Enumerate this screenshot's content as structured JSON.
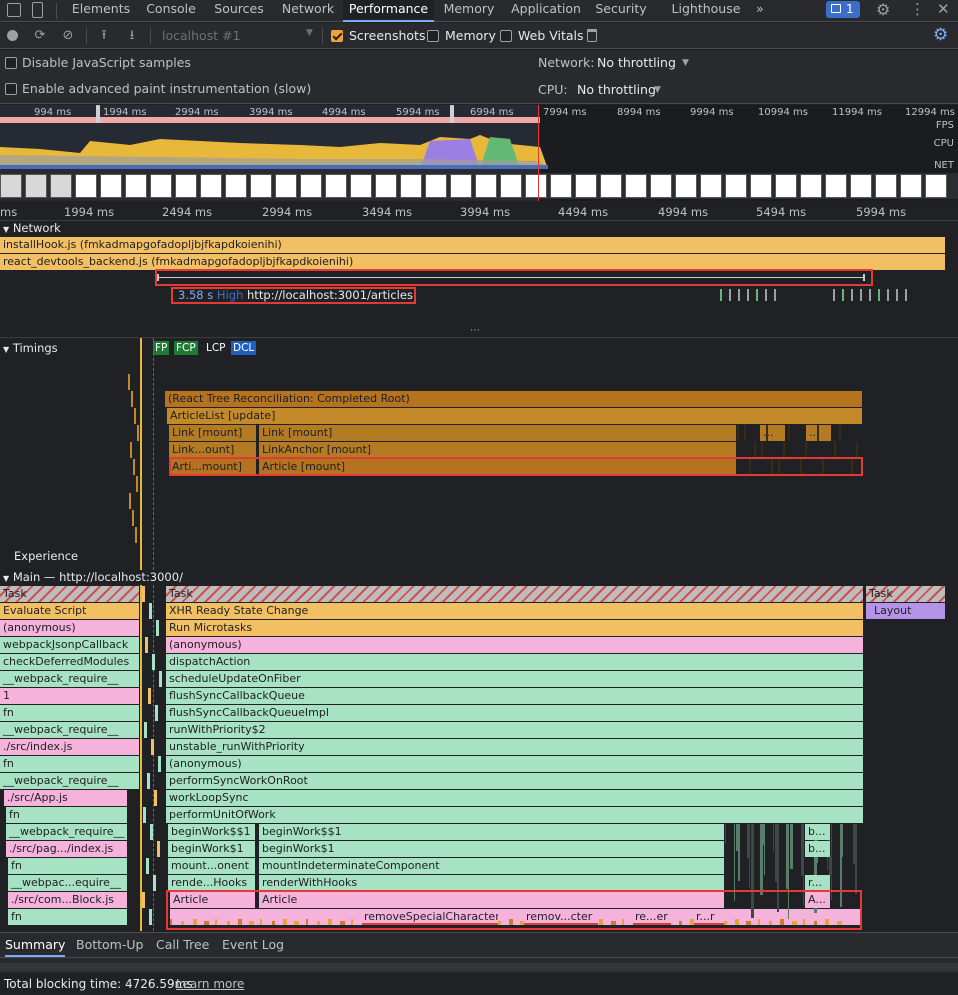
{
  "tabs": [
    "Elements",
    "Console",
    "Sources",
    "Network",
    "Performance",
    "Memory",
    "Application",
    "Security",
    "Lighthouse"
  ],
  "active_tab": "Performance",
  "more_tabs": "»",
  "issues_count": "1",
  "toolbar": {
    "profile_select": "localhost #1",
    "screenshots_label": "Screenshots",
    "memory_label": "Memory",
    "web_vitals_label": "Web Vitals"
  },
  "settings": {
    "disable_js_samples": "Disable JavaScript samples",
    "enable_paint": "Enable advanced paint instrumentation (slow)",
    "network_label": "Network:",
    "network_value": "No throttling",
    "cpu_label": "CPU:",
    "cpu_value": "No throttling"
  },
  "overview": {
    "ticks": [
      "994 ms",
      "1994 ms",
      "2994 ms",
      "3994 ms",
      "4994 ms",
      "5994 ms",
      "6994 ms",
      "7994 ms",
      "8994 ms",
      "9994 ms",
      "10994 ms",
      "11994 ms",
      "12994 ms"
    ],
    "fps": "FPS",
    "cpu": "CPU",
    "net": "NET"
  },
  "ruler": [
    "ms",
    "1994 ms",
    "2494 ms",
    "2994 ms",
    "3494 ms",
    "3994 ms",
    "4494 ms",
    "4994 ms",
    "5494 ms",
    "5994 ms"
  ],
  "network": {
    "title": "Network",
    "req1": "installHook.js (fmkadmapgofadopljbjfkapdkoienihi)",
    "req2": "react_devtools_backend.js (fmkadmapgofadopljbjfkapdkoienihi)",
    "tooltip_time": "3.58 s",
    "tooltip_priority": "High",
    "tooltip_url": "http://localhost:3001/articles"
  },
  "timings": {
    "title": "Timings",
    "fp": "FP",
    "fcp": "FCP",
    "lcp": "LCP",
    "dcl": "DCL",
    "bars": {
      "reconcile": "(React Tree Reconciliation: Completed Root)",
      "articlelist": "ArticleList [update]",
      "link1": "Link [mount]",
      "link2": "Link [mount]",
      "linka": "Link...ount]",
      "linkanchor": "LinkAnchor [mount]",
      "arti": "Arti...mount]",
      "article": "Article [mount]",
      "dots": "...",
      "dots2": "..."
    }
  },
  "experience": "Experience",
  "main": {
    "title": "Main — http://localhost:3000/",
    "left_stack": [
      "Task",
      "Evaluate Script",
      "(anonymous)",
      "webpackJsonpCallback",
      "checkDeferredModules",
      "__webpack_require__",
      "1",
      "fn",
      "__webpack_require__",
      "./src/index.js",
      "fn",
      "__webpack_require__",
      "./src/App.js",
      "fn",
      "__webpack_require__",
      "./src/pag.../index.js",
      "fn",
      "__webpac...equire__",
      "./src/com...Block.js",
      "fn"
    ],
    "right_stack": [
      "Task",
      "XHR Ready State Change",
      "Run Microtasks",
      "(anonymous)",
      "dispatchAction",
      "scheduleUpdateOnFiber",
      "flushSyncCallbackQueue",
      "flushSyncCallbackQueueImpl",
      "runWithPriority$2",
      "unstable_runWithPriority",
      "(anonymous)",
      "performSyncWorkOnRoot",
      "workLoopSync",
      "performUnitOfWork"
    ],
    "begin1": "beginWork$$1",
    "begin1b": "beginWork$$1",
    "begin2": "beginWork$1",
    "begin2b": "beginWork$1",
    "mount_short": "mount...onent",
    "mount_long": "mountIndeterminateComponent",
    "render_short": "rende...Hooks",
    "render_long": "renderWithHooks",
    "article_a": "Article",
    "article_b": "Article",
    "remove1": "removeSpecialCharacter",
    "remove2": "remov...cter",
    "remove3": "re...er",
    "remove4": "r...r",
    "b1": "b...",
    "b2": "b...",
    "r1": "r...",
    "a1": "A...",
    "task3": "Task",
    "layout": "Layout"
  },
  "bottom": {
    "tabs": [
      "Summary",
      "Bottom-Up",
      "Call Tree",
      "Event Log"
    ],
    "active": "Summary",
    "blocking_label": "Total blocking time: 4726.59ms",
    "learn_more": "Learn more"
  },
  "colors": {
    "accent": "#7cacf8",
    "highlight": "#e53935",
    "script": "#f2c063",
    "js": "#a8e2c4",
    "pink": "#f5b3db"
  }
}
